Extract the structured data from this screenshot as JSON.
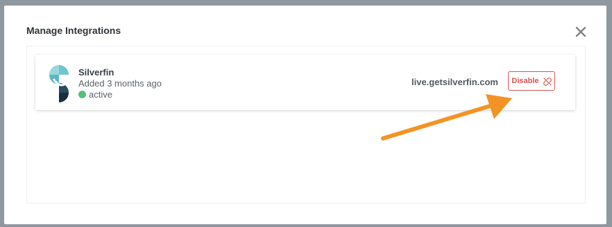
{
  "modal": {
    "title": "Manage Integrations",
    "close_icon": "close-icon"
  },
  "integration": {
    "name": "Silverfin",
    "added": "Added 3 months ago",
    "status": "active",
    "status_color": "#52c17a",
    "domain": "live.getsilverfin.com",
    "disable_label": "Disable",
    "disable_icon": "unlink-icon",
    "logo_icon": "silverfin-logo-icon"
  },
  "colors": {
    "danger": "#d9534f",
    "annotation_arrow": "#f39325",
    "logo_teal": "#6ec5cc",
    "logo_navy": "#1a2e3e"
  }
}
